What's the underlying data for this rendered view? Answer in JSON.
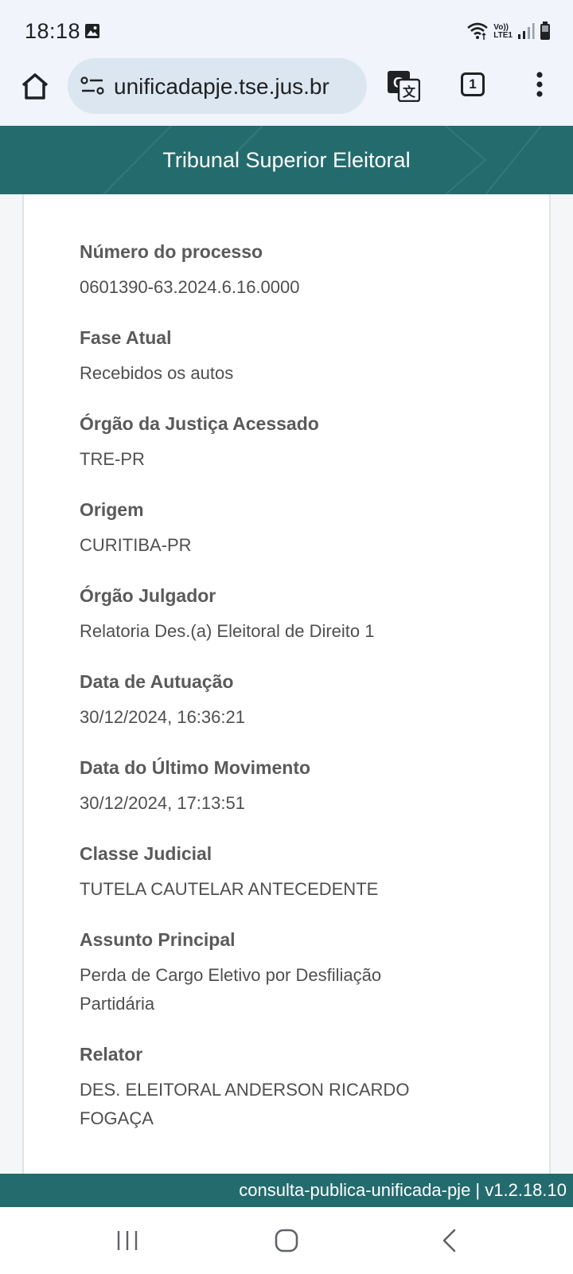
{
  "status_bar": {
    "time": "18:18",
    "network_label_top": "Vo))",
    "network_label_bottom": "LTE1"
  },
  "browser": {
    "url": "unificadapje.tse.jus.br",
    "tab_count": "1"
  },
  "header": {
    "title": "Tribunal Superior Eleitoral"
  },
  "fields": [
    {
      "label": "Número do processo",
      "value": "0601390-63.2024.6.16.0000"
    },
    {
      "label": "Fase Atual",
      "value": "Recebidos os autos"
    },
    {
      "label": "Órgão da Justiça Acessado",
      "value": "TRE-PR"
    },
    {
      "label": "Origem",
      "value": "CURITIBA-PR"
    },
    {
      "label": "Órgão Julgador",
      "value": "Relatoria Des.(a) Eleitoral de Direito 1"
    },
    {
      "label": "Data de Autuação",
      "value": "30/12/2024, 16:36:21"
    },
    {
      "label": "Data do Último Movimento",
      "value": "30/12/2024, 17:13:51"
    },
    {
      "label": "Classe Judicial",
      "value": "TUTELA CAUTELAR ANTECEDENTE"
    },
    {
      "label": "Assunto Principal",
      "value": "Perda de Cargo Eletivo por Desfiliação Partidária"
    },
    {
      "label": "Relator",
      "value": "DES. ELEITORAL ANDERSON RICARDO FOGAÇA"
    }
  ],
  "footer": {
    "text": "consulta-publica-unificada-pje | v1.2.18.10"
  },
  "colors": {
    "brand_teal": "#246b6e",
    "chrome_background": "#f1f4fb",
    "address_bar_background": "#dbe6f0"
  },
  "icons": {
    "status": [
      "gallery-icon",
      "wifi-icon",
      "signal-icon",
      "battery-icon"
    ],
    "browser": [
      "home-icon",
      "site-settings-icon",
      "translate-icon",
      "tab-switcher-icon",
      "more-options-icon"
    ],
    "navigation": [
      "recents-icon",
      "home-nav-icon",
      "back-icon"
    ]
  }
}
